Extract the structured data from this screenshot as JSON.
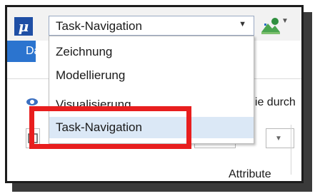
{
  "toolbar": {
    "app_icon_label": "μ",
    "combo_value": "Task-Navigation",
    "tool_icon": "landscape-icon"
  },
  "ribbon": {
    "active_tab_label": "Daten",
    "background_text": "nie durch",
    "group_label": "Attribute"
  },
  "dropdown": {
    "items": [
      {
        "label": "Zeichnung"
      },
      {
        "label": "Modellierung"
      },
      {
        "label": "Visualisierung"
      },
      {
        "label": "Task-Navigation"
      }
    ],
    "selected_index": 3
  },
  "colors": {
    "accent": "#2b74cf",
    "selection": "#dbe8f6",
    "highlight": "#e81e1e"
  }
}
